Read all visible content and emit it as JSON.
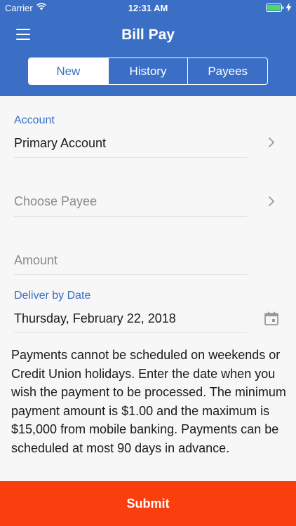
{
  "status_bar": {
    "carrier": "Carrier",
    "time": "12:31 AM"
  },
  "header": {
    "title": "Bill Pay",
    "background_color": "#3b6fc6",
    "tabs": [
      {
        "label": "New",
        "active": true
      },
      {
        "label": "History",
        "active": false
      },
      {
        "label": "Payees",
        "active": false
      }
    ]
  },
  "form": {
    "account": {
      "label": "Account",
      "value": "Primary Account"
    },
    "payee": {
      "placeholder": "Choose Payee"
    },
    "amount": {
      "placeholder": "Amount"
    },
    "deliver_date": {
      "label": "Deliver by Date",
      "value": "Thursday, February 22, 2018"
    }
  },
  "info_text": "Payments cannot be scheduled on weekends or Credit Union holidays. Enter the date when you wish the payment to be processed. The minimum payment amount is $1.00 and the maximum is $15,000 from mobile banking. Payments can be scheduled at most 90 days in advance.",
  "submit": {
    "label": "Submit",
    "color": "#fb3e0e"
  },
  "icons": [
    "wifi-icon",
    "battery-icon",
    "charging-bolt-icon",
    "menu-icon",
    "chevron-right-icon",
    "calendar-icon"
  ]
}
